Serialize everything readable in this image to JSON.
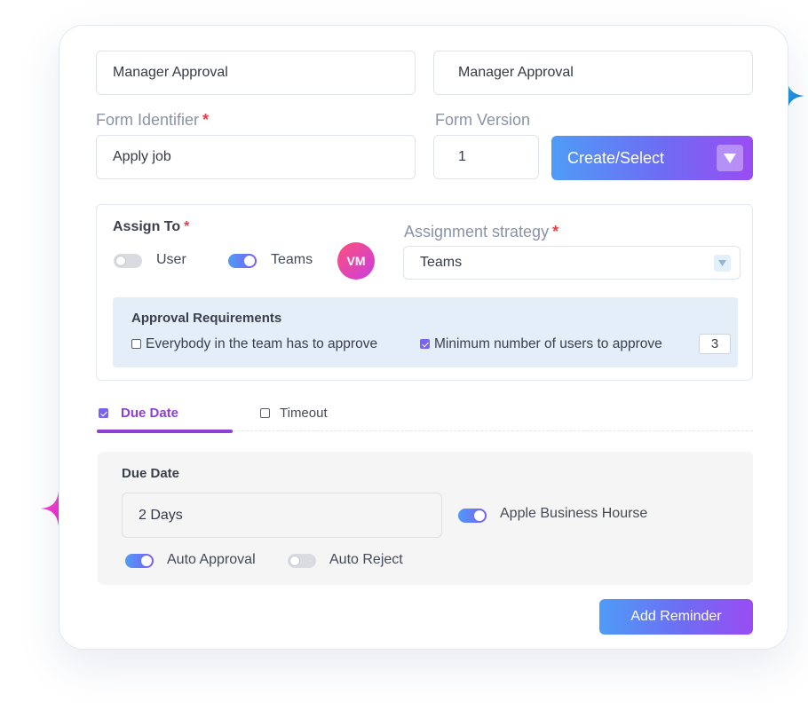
{
  "form": {
    "name_value": "Manager Approval",
    "display_name_value": "Manager Approval",
    "identifier_label": "Form Identifier",
    "identifier_required": "*",
    "identifier_value": "Apply job",
    "version_label": "Form Version",
    "version_value": "1",
    "create_select_label": "Create/Select"
  },
  "assign": {
    "label": "Assign To",
    "required": "*",
    "user_label": "User",
    "user_on": false,
    "teams_label": "Teams",
    "teams_on": true,
    "avatar_initials": "VM",
    "strategy_label": "Assignment strategy",
    "strategy_required": "*",
    "strategy_value": "Teams"
  },
  "approval": {
    "title": "Approval Requirements",
    "everybody_label": "Everybody in the team has to approve",
    "everybody_checked": false,
    "minimum_label": "Minimum number of users to approve",
    "minimum_checked": true,
    "minimum_value": "3"
  },
  "tabs": [
    {
      "label": "Due Date",
      "checked": true,
      "active": true
    },
    {
      "label": "Timeout",
      "checked": false,
      "active": false
    }
  ],
  "due": {
    "title": "Due Date",
    "value": "2 Days",
    "business_hours_label": "Apple Business Hourse",
    "business_hours_on": true,
    "auto_approval_label": "Auto Approval",
    "auto_approval_on": true,
    "auto_reject_label": "Auto Reject",
    "auto_reject_on": false
  },
  "actions": {
    "add_reminder_label": "Add Reminder"
  },
  "colors": {
    "accent_gradient_start": "#4f9cf7",
    "accent_gradient_end": "#9a4cf3",
    "tab_active": "#8e3fd6",
    "required": "#ef3b46",
    "approval_bg": "#e3eef8",
    "due_bg": "#f5f5f5",
    "sparkle_blue": "#1a9fe0",
    "sparkle_pink": "#f23bd0"
  }
}
